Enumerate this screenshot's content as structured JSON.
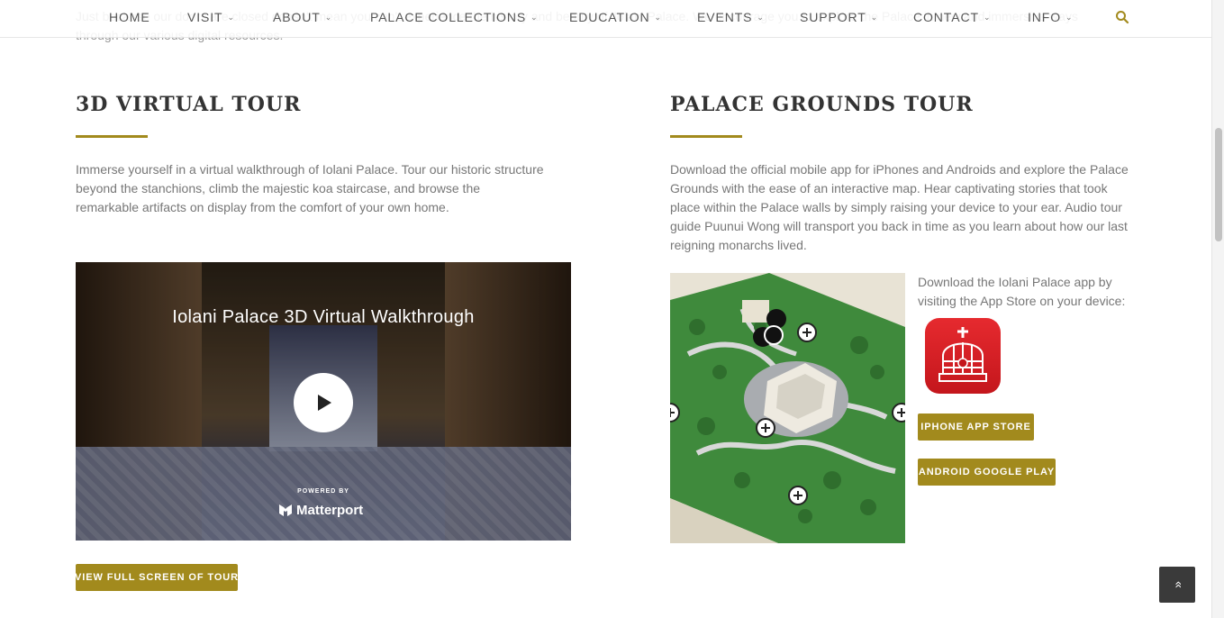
{
  "intro_text": "Just because our doors are closed doesn't mean you can't experience the history and beauty of 'Iolani Palace. We encourage you to explore the Palace in new and immersive ways through our various digital resources.",
  "nav": {
    "items": [
      {
        "label": "HOME",
        "has_dropdown": false
      },
      {
        "label": "VISIT",
        "has_dropdown": true
      },
      {
        "label": "ABOUT",
        "has_dropdown": true
      },
      {
        "label": "PALACE COLLECTIONS",
        "has_dropdown": true
      },
      {
        "label": "EDUCATION",
        "has_dropdown": true
      },
      {
        "label": "EVENTS",
        "has_dropdown": true
      },
      {
        "label": "SUPPORT",
        "has_dropdown": true
      },
      {
        "label": "CONTACT",
        "has_dropdown": true
      },
      {
        "label": "INFO",
        "has_dropdown": true
      }
    ],
    "search_icon": "search-icon"
  },
  "virtual_tour": {
    "heading": "3D VIRTUAL TOUR",
    "body": "Immerse yourself in a virtual walkthrough of Iolani Palace. Tour our historic structure beyond the stanchions, climb the majestic koa staircase, and browse the remarkable artifacts on display from the comfort of your own home.",
    "video": {
      "title": "Iolani Palace 3D Virtual Walkthrough",
      "powered_by": "POWERED BY",
      "brand": "Matterport"
    },
    "button": "VIEW FULL SCREEN OF TOUR"
  },
  "grounds_tour": {
    "heading": "PALACE GROUNDS TOUR",
    "body": "Download the official mobile app for iPhones and Androids and explore the Palace Grounds with the ease of an interactive map. Hear captivating stories that took place within the Palace walls by simply raising your device to your ear. Audio tour guide Puunui Wong will transport you back in time as you learn about how our last reigning monarchs lived.",
    "download_text": "Download the Iolani Palace app by visiting the App Store on your device:",
    "iphone_button": "IPHONE APP STORE",
    "android_button": "ANDROID GOOGLE PLAY"
  },
  "colors": {
    "accent_gold": "#a28a1d",
    "heading": "#333333",
    "body_text": "#777777",
    "app_icon_red": "#d8202a"
  }
}
